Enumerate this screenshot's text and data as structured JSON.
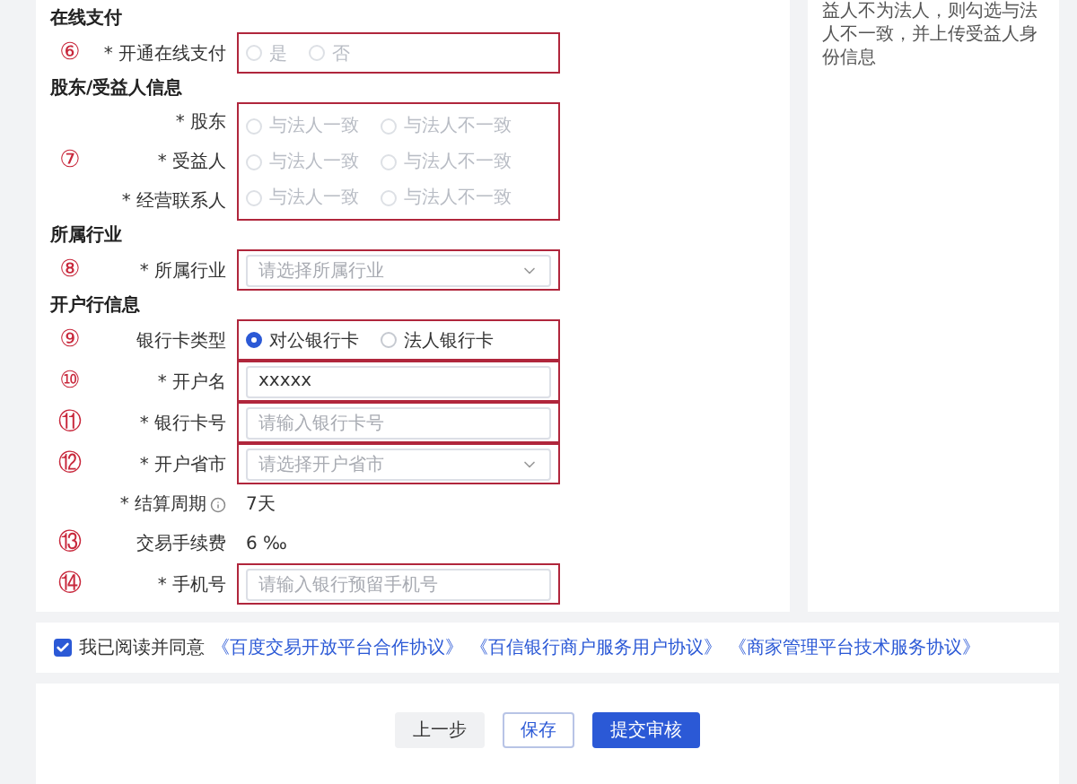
{
  "sections": [
    {
      "title": "在线支付",
      "groups": [
        {
          "marker": "⑥",
          "boxed": true,
          "rows": [
            {
              "label": "* 开通在线支付",
              "kind": "radio",
              "disabled": true,
              "options": [
                {
                  "label": "是",
                  "selected": false
                },
                {
                  "label": "否",
                  "selected": false
                }
              ]
            }
          ]
        }
      ]
    },
    {
      "title": "股东/受益人信息",
      "groups": [
        {
          "marker": "⑦",
          "boxed": true,
          "rows": [
            {
              "label": "* 股东",
              "kind": "radio",
              "disabled": true,
              "options": [
                {
                  "label": "与法人一致",
                  "selected": false
                },
                {
                  "label": "与法人不一致",
                  "selected": false
                }
              ]
            },
            {
              "label": "* 受益人",
              "kind": "radio",
              "disabled": true,
              "options": [
                {
                  "label": "与法人一致",
                  "selected": false
                },
                {
                  "label": "与法人不一致",
                  "selected": false
                }
              ]
            },
            {
              "label": "* 经营联系人",
              "kind": "radio",
              "disabled": true,
              "options": [
                {
                  "label": "与法人一致",
                  "selected": false
                },
                {
                  "label": "与法人不一致",
                  "selected": false
                }
              ]
            }
          ]
        }
      ]
    },
    {
      "title": "所属行业",
      "groups": [
        {
          "marker": "⑧",
          "boxed": true,
          "rows": [
            {
              "label": "* 所属行业",
              "kind": "select",
              "placeholder": "请选择所属行业"
            }
          ]
        }
      ]
    },
    {
      "title": "开户行信息",
      "groups": [
        {
          "marker": "⑨",
          "boxed": true,
          "rows": [
            {
              "label": "银行卡类型",
              "kind": "radio",
              "disabled": false,
              "options": [
                {
                  "label": "对公银行卡",
                  "selected": true
                },
                {
                  "label": "法人银行卡",
                  "selected": false
                }
              ]
            }
          ]
        },
        {
          "marker": "⑩",
          "boxed": true,
          "rows": [
            {
              "label": "* 开户名",
              "kind": "input",
              "value": "xxxxx"
            }
          ]
        },
        {
          "marker": "⑪",
          "boxed": true,
          "rows": [
            {
              "label": "* 银行卡号",
              "kind": "input",
              "placeholder": "请输入银行卡号"
            }
          ]
        },
        {
          "marker": "⑫",
          "boxed": true,
          "rows": [
            {
              "label": "* 开户省市",
              "kind": "select",
              "placeholder": "请选择开户省市"
            }
          ]
        },
        {
          "boxed": false,
          "rows": [
            {
              "label": "* 结算周期",
              "kind": "text",
              "info": true,
              "value": "7天"
            }
          ]
        },
        {
          "marker": "⑬",
          "boxed": false,
          "rows": [
            {
              "label": "交易手续费",
              "kind": "text",
              "value": "6 ‰"
            }
          ]
        },
        {
          "marker": "⑭",
          "boxed": true,
          "rows": [
            {
              "label": "* 手机号",
              "kind": "input",
              "placeholder": "请输入银行预留手机号"
            }
          ]
        }
      ]
    }
  ],
  "side_note": "益人不为法人，则勾选与法人不一致，并上传受益人身份信息",
  "agreement": {
    "checked": true,
    "label": "我已阅读并同意",
    "links": [
      "《百度交易开放平台合作协议》",
      "《百信银行商户服务用户协议》",
      "《商家管理平台技术服务协议》"
    ]
  },
  "buttons": [
    {
      "label": "上一步",
      "kind": "secondary"
    },
    {
      "label": "保存",
      "kind": "outline"
    },
    {
      "label": "提交审核",
      "kind": "primary"
    }
  ]
}
